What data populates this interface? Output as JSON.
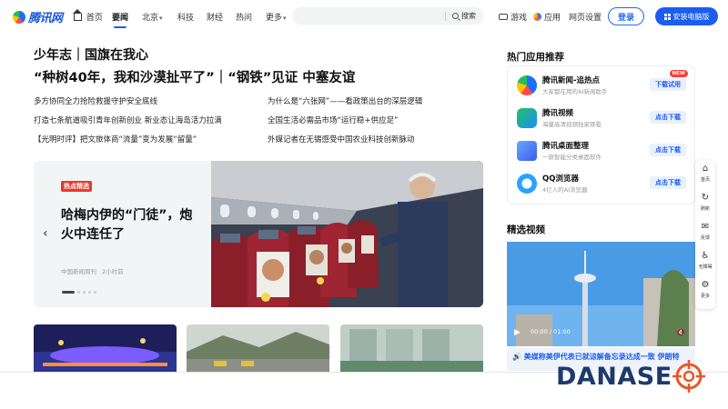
{
  "nav": {
    "logo_text": "腾讯网",
    "items": [
      {
        "label": "首页"
      },
      {
        "label": "要闻"
      },
      {
        "label": "北京"
      },
      {
        "label": "科技"
      },
      {
        "label": "财经"
      },
      {
        "label": "热问"
      },
      {
        "label": "更多"
      }
    ],
    "search_label": "搜索",
    "game_label": "游戏",
    "app_label": "应用",
    "settings_label": "网页设置",
    "login_label": "登录",
    "install_label": "安装电脑版"
  },
  "headlines": {
    "section_title": "少年志｜国旗在我心",
    "main_title": "“种树40年，我和沙漠扯平了”｜“钢铁”见证 中塞友谊",
    "links": [
      "多方协同全力抢险救援守护安全底线",
      "为什么是“六张网”——看政策出台的深层逻辑",
      "打造七条航道吸引青年创新创业 新业态让海岛活力拉满",
      "全国生活必需品市场“运行稳+供应足”",
      "【光明时评】把文旅体商“流量”变为发展“留量”",
      "外媒记者在无锡感受中国农业科技创新脉动"
    ]
  },
  "carousel": {
    "tag": "热点精选",
    "title": "哈梅内伊的“门徒”，炮火中连任了",
    "source": "中国新闻周刊",
    "time": "2小时前",
    "slide_index": 1,
    "slide_count": 5
  },
  "sidebar": {
    "apps_title": "热门应用推荐",
    "apps": [
      {
        "name": "腾讯新闻-追热点",
        "desc": "大家都在用的AI新闻助手",
        "button": "下载试用",
        "badge": "NEW"
      },
      {
        "name": "腾讯视频",
        "desc": "海量高清视频独家观看",
        "button": "点击下载"
      },
      {
        "name": "腾讯桌面整理",
        "desc": "一款智能分类桌面软件",
        "button": "点击下载"
      },
      {
        "name": "QQ浏览器",
        "desc": "4亿人的AI浏览器",
        "button": "点击下载"
      }
    ],
    "video_title": "精选视频",
    "video_caption": "🔊 美媒称美伊代表已就谅解备忘录达成一致 伊朗特",
    "video_time": "00:00 / 01:00"
  },
  "float_bar": [
    {
      "label": "首页",
      "icon": "home-icon"
    },
    {
      "label": "刷新",
      "icon": "refresh-icon"
    },
    {
      "label": "反馈",
      "icon": "feedback-icon"
    },
    {
      "label": "无障碍",
      "icon": "accessibility-icon"
    },
    {
      "label": "更多",
      "icon": "more-icon"
    }
  ],
  "watermark": {
    "text": "DANASE"
  },
  "colors": {
    "brand_blue": "#1b5df2",
    "hot_red": "#e8382c",
    "watermark_navy": "#1e3a6d",
    "watermark_orange": "#e8572a"
  }
}
